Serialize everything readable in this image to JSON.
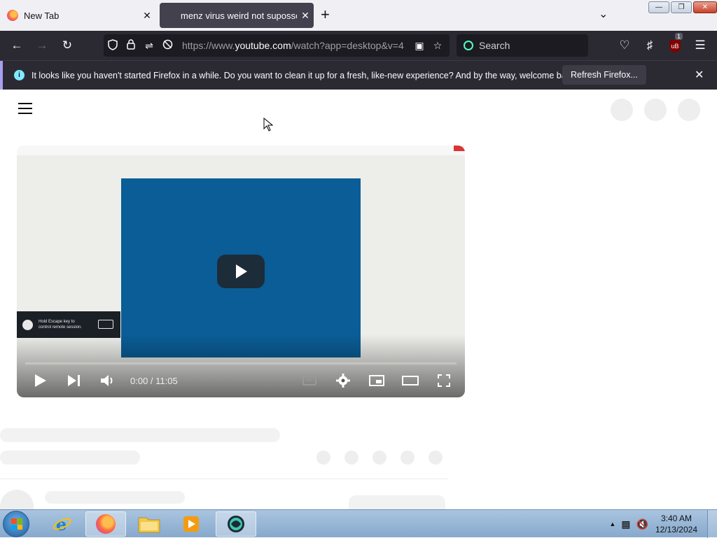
{
  "tabs": [
    {
      "label": "New Tab",
      "icon": "firefox-icon",
      "active": false
    },
    {
      "label": "menz virus weird not supossed to happen",
      "active": true
    }
  ],
  "toolbar": {
    "back": "back-arrow-icon",
    "forward": "forward-arrow-icon",
    "reload": "reload-icon"
  },
  "urlbar": {
    "prefix": "https://www.",
    "domain": "youtube.com",
    "path": "/watch?app=desktop&v=4"
  },
  "search": {
    "placeholder": "Search"
  },
  "extensions": {
    "ublock_badge": "1"
  },
  "notification": {
    "message": "It looks like you haven't started Firefox in a while. Do you want to clean it up for a fresh, like-new experience? And by the way, welcome back!",
    "button": "Refresh Firefox..."
  },
  "video": {
    "time": "0:00 / 11:05",
    "overlay_text": "Hold Escape key to control remote session.",
    "progress_fraction": 0
  },
  "taskbar": {
    "time": "3:40 AM",
    "date": "12/13/2024"
  },
  "colors": {
    "browser_dark": "#2b2a33",
    "urlbar_bg": "#1c1b22",
    "video_blue": "#0a5d96",
    "taskbar": "#87a9cc"
  }
}
